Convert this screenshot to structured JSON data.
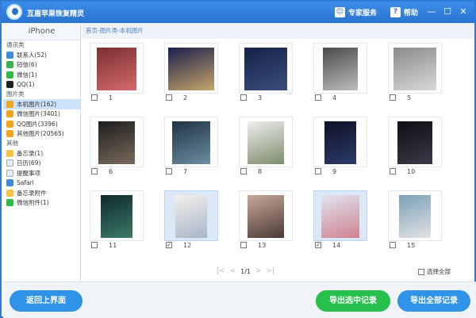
{
  "titlebar": {
    "title": "互盾苹果恢复精灵",
    "service_label": "专家服务",
    "help_label": "帮助",
    "minimize": "—",
    "maximize": "☐",
    "close": "✕"
  },
  "sidebar": {
    "device": "iPhone",
    "groups": [
      {
        "label": "通讯类",
        "items": [
          {
            "label": "联系人(52)",
            "color": "#3c8ad8",
            "icon": "contacts-icon"
          },
          {
            "label": "短信(6)",
            "color": "#37b24d",
            "icon": "sms-icon"
          },
          {
            "label": "微信(1)",
            "color": "#2dbb3f",
            "icon": "wechat-icon"
          },
          {
            "label": "QQ(1)",
            "color": "#222222",
            "icon": "qq-icon"
          }
        ]
      },
      {
        "label": "图片类",
        "items": [
          {
            "label": "本机图片(162)",
            "color": "#f2a51a",
            "icon": "photos-icon",
            "active": true
          },
          {
            "label": "微信图片(3401)",
            "color": "#f2a51a",
            "icon": "wechat-photos-icon"
          },
          {
            "label": "QQ图片(3396)",
            "color": "#f2a51a",
            "icon": "qq-photos-icon"
          },
          {
            "label": "其他图片(20565)",
            "color": "#f2a51a",
            "icon": "other-photos-icon"
          }
        ]
      },
      {
        "label": "其他",
        "items": [
          {
            "label": "备忘录(1)",
            "color": "#f5c542",
            "icon": "notes-icon"
          },
          {
            "label": "日历(69)",
            "color": "#e9eef5",
            "icon": "calendar-icon"
          },
          {
            "label": "提醒事项",
            "color": "#e9eef5",
            "icon": "reminders-icon"
          },
          {
            "label": "Safari",
            "color": "#3c8ad8",
            "icon": "safari-icon"
          },
          {
            "label": "备忘录附件",
            "color": "#f5c542",
            "icon": "notes-attachment-icon"
          },
          {
            "label": "微信附件(1)",
            "color": "#2dbb3f",
            "icon": "wechat-attachment-icon"
          }
        ]
      }
    ]
  },
  "main": {
    "breadcrumb": "首页-图片类-本机图片",
    "photos": [
      {
        "num": "1",
        "checked": false,
        "colors": [
          "#7a2f30",
          "#d46a6f"
        ]
      },
      {
        "num": "2",
        "checked": false,
        "colors": [
          "#1a1f4d",
          "#c7a56a"
        ]
      },
      {
        "num": "3",
        "checked": false,
        "colors": [
          "#16234a",
          "#3a4d7a"
        ]
      },
      {
        "num": "4",
        "checked": false,
        "colors": [
          "#4a4a4a",
          "#bdbdbd"
        ]
      },
      {
        "num": "5",
        "checked": false,
        "colors": [
          "#8a8a8a",
          "#d9d9d9"
        ]
      },
      {
        "num": "6",
        "checked": false,
        "colors": [
          "#1d1d1d",
          "#7a6a5a"
        ]
      },
      {
        "num": "7",
        "checked": false,
        "colors": [
          "#1f3444",
          "#6d8da0"
        ]
      },
      {
        "num": "8",
        "checked": false,
        "colors": [
          "#eeeeee",
          "#7d8c6a"
        ]
      },
      {
        "num": "9",
        "checked": false,
        "colors": [
          "#0d1226",
          "#2c3a6a"
        ]
      },
      {
        "num": "10",
        "checked": false,
        "colors": [
          "#0e0e14",
          "#3a3a4a"
        ]
      },
      {
        "num": "11",
        "checked": false,
        "colors": [
          "#0f2a2a",
          "#3a7a6a"
        ]
      },
      {
        "num": "12",
        "checked": true,
        "colors": [
          "#f4f0ec",
          "#a7b5c7"
        ]
      },
      {
        "num": "13",
        "checked": false,
        "colors": [
          "#c9a89a",
          "#4a3a35"
        ]
      },
      {
        "num": "14",
        "checked": true,
        "colors": [
          "#dfe6f0",
          "#d08090"
        ]
      },
      {
        "num": "15",
        "checked": false,
        "colors": [
          "#7aa0b8",
          "#e3e3e3"
        ]
      }
    ],
    "pager": {
      "first": "|<",
      "prev": "<",
      "info": "1/1",
      "next": ">",
      "last": ">|"
    },
    "select_all_label": "选择全部"
  },
  "footer": {
    "back_label": "返回上界面",
    "export_selected_label": "导出选中记录",
    "export_all_label": "导出全部记录"
  }
}
